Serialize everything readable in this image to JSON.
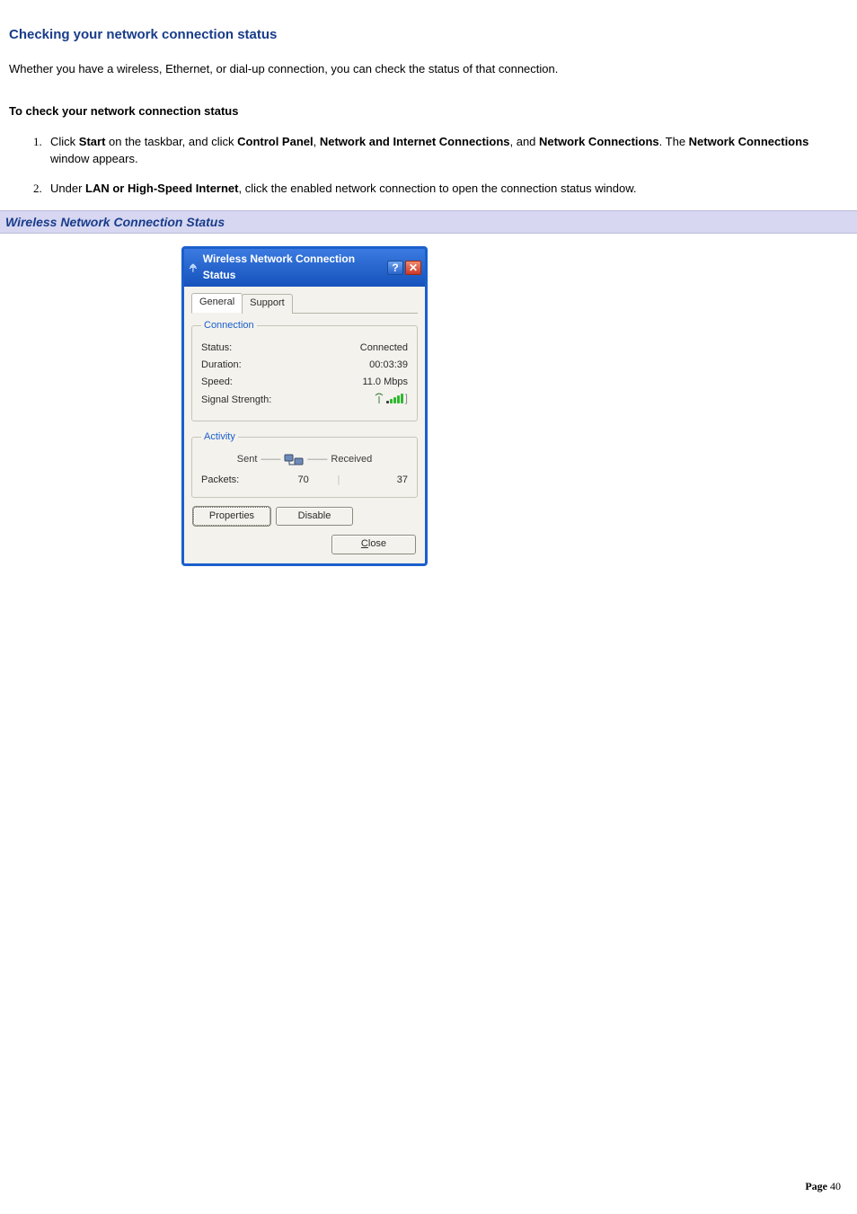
{
  "doc": {
    "heading": "Checking your network connection status",
    "intro": "Whether you have a wireless, Ethernet, or dial-up connection, you can check the status of that connection.",
    "sub_heading": "To check your network connection status",
    "steps": {
      "s1_a": "Click ",
      "s1_b": "Start",
      "s1_c": " on the taskbar, and click ",
      "s1_d": "Control Panel",
      "s1_e": ", ",
      "s1_f": "Network and Internet Connections",
      "s1_g": ", and ",
      "s1_h": "Network Connections",
      "s1_i": ". The ",
      "s1_j": "Network Connections",
      "s1_k": " window appears.",
      "s2_a": "Under ",
      "s2_b": "LAN or High-Speed Internet",
      "s2_c": ", click the enabled network connection to open the connection status window."
    },
    "caption": "Wireless Network Connection Status",
    "page_label": "Page ",
    "page_num": "40"
  },
  "dialog": {
    "title": "Wireless Network Connection Status",
    "help_glyph": "?",
    "close_glyph": "✕",
    "tabs": {
      "general": "General",
      "support": "Support"
    },
    "connection": {
      "legend": "Connection",
      "status_label": "Status:",
      "status_value": "Connected",
      "duration_label": "Duration:",
      "duration_value": "00:03:39",
      "speed_label": "Speed:",
      "speed_value": "11.0 Mbps",
      "signal_label": "Signal Strength:"
    },
    "activity": {
      "legend": "Activity",
      "sent": "Sent",
      "received": "Received",
      "packets_label": "Packets:",
      "packets_sent": "70",
      "packets_received": "37"
    },
    "buttons": {
      "properties": "Properties",
      "disable": "Disable",
      "close": "Close"
    }
  }
}
